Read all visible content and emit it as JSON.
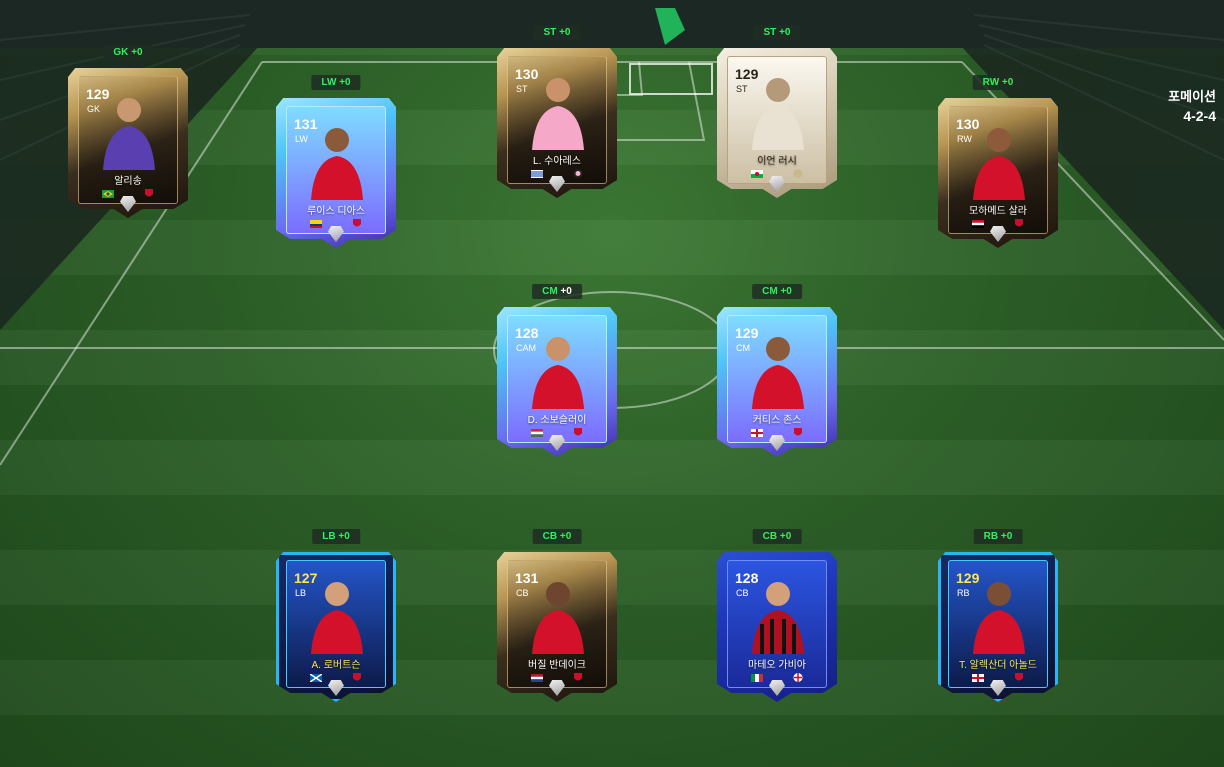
{
  "formation": {
    "label": "포메이션",
    "value": "4-2-4"
  },
  "colors": {
    "badge_green": "#31f05a",
    "pitch_green": "#2c5f27"
  },
  "slots": [
    {
      "id": "gk",
      "badge_pos": "GK",
      "badge_plus": "+0",
      "ovr": "129",
      "pos": "GK",
      "name": "알리송",
      "style": "gold",
      "flag": "brazil-flag-icon",
      "club": "liverpool-crest-icon"
    },
    {
      "id": "lw",
      "badge_pos": "LW",
      "badge_plus": "+0",
      "ovr": "131",
      "pos": "LW",
      "name": "루이스 디아스",
      "style": "blue",
      "flag": "colombia-flag-icon",
      "club": "liverpool-crest-icon"
    },
    {
      "id": "st1",
      "badge_pos": "ST",
      "badge_plus": "+0",
      "ovr": "130",
      "pos": "ST",
      "name": "L. 수아레스",
      "style": "gold",
      "flag": "uruguay-flag-icon",
      "club": "inter-miami-crest-icon"
    },
    {
      "id": "st2",
      "badge_pos": "ST",
      "badge_plus": "+0",
      "ovr": "129",
      "pos": "ST",
      "name": "이언 러시",
      "style": "icon",
      "flag": "wales-flag-icon",
      "club": "icon-crest-icon"
    },
    {
      "id": "rw",
      "badge_pos": "RW",
      "badge_plus": "+0",
      "ovr": "130",
      "pos": "RW",
      "name": "모하메드 살라",
      "style": "gold",
      "flag": "egypt-flag-icon",
      "club": "liverpool-crest-icon"
    },
    {
      "id": "cm1",
      "badge_pos": "CM",
      "badge_plus": "+0",
      "ovr": "128",
      "pos": "CAM",
      "name": "D. 소보슬러이",
      "style": "blue",
      "flag": "hungary-flag-icon",
      "club": "liverpool-crest-icon"
    },
    {
      "id": "cm2",
      "badge_pos": "CM",
      "badge_plus": "+0",
      "ovr": "129",
      "pos": "CM",
      "name": "커티스 존스",
      "style": "blue",
      "flag": "england-flag-icon",
      "club": "liverpool-crest-icon"
    },
    {
      "id": "lb",
      "badge_pos": "LB",
      "badge_plus": "+0",
      "ovr": "127",
      "pos": "LB",
      "name": "A. 로버트슨",
      "style": "neon",
      "flag": "scotland-flag-icon",
      "club": "liverpool-crest-icon"
    },
    {
      "id": "cb1",
      "badge_pos": "CB",
      "badge_plus": "+0",
      "ovr": "131",
      "pos": "CB",
      "name": "버질 반데이크",
      "style": "gold",
      "flag": "netherlands-flag-icon",
      "club": "liverpool-crest-icon"
    },
    {
      "id": "cb2",
      "badge_pos": "CB",
      "badge_plus": "+0",
      "ovr": "128",
      "pos": "CB",
      "name": "마테오 가비아",
      "style": "navy",
      "flag": "italy-flag-icon",
      "club": "ac-milan-crest-icon"
    },
    {
      "id": "rb",
      "badge_pos": "RB",
      "badge_plus": "+0",
      "ovr": "129",
      "pos": "RB",
      "name": "T. 알렉산더 아놀드",
      "style": "neon",
      "flag": "england-flag-icon",
      "club": "liverpool-crest-icon"
    }
  ]
}
